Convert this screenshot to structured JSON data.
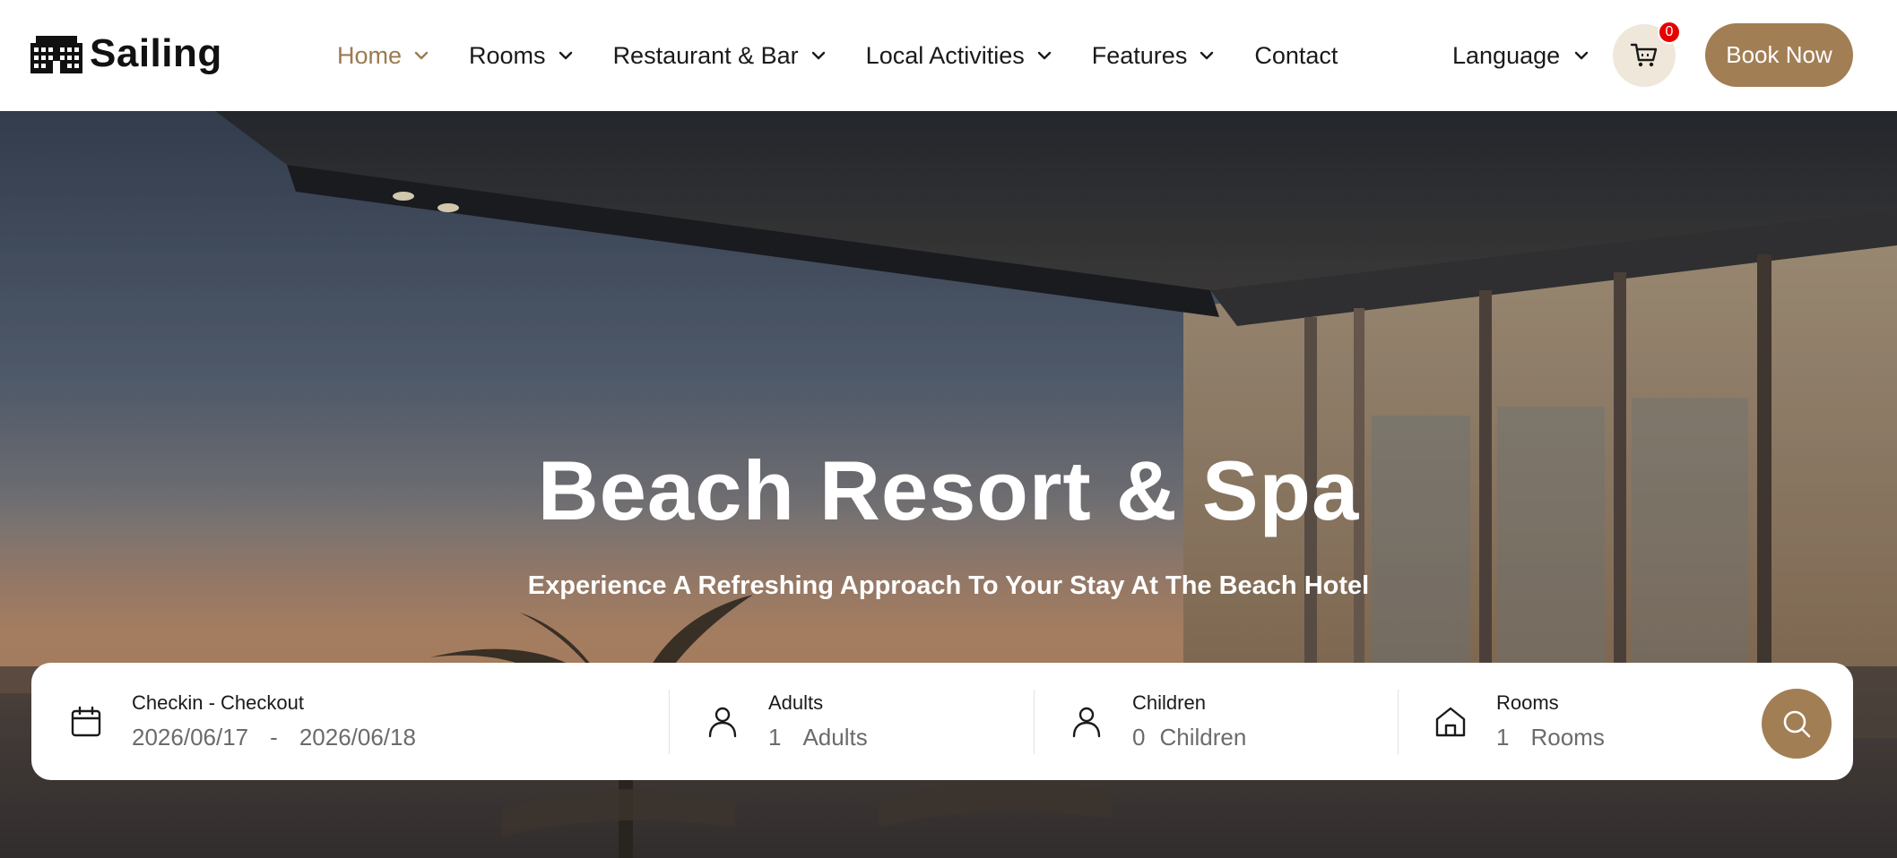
{
  "brand": {
    "name": "Sailing",
    "logo_icon": "hotel-building-icon"
  },
  "nav": {
    "items": [
      {
        "label": "Home",
        "active": true
      },
      {
        "label": "Rooms"
      },
      {
        "label": "Restaurant & Bar"
      },
      {
        "label": "Local Activities"
      },
      {
        "label": "Features"
      },
      {
        "label": "Contact"
      }
    ],
    "language_label": "Language"
  },
  "cart": {
    "count": "0",
    "icon": "cart-icon"
  },
  "book_button": {
    "label": "Book Now"
  },
  "hero": {
    "title": "Beach Resort & Spa",
    "subtitle": "Experience A Refreshing Approach To Your Stay At The Beach Hotel"
  },
  "booking": {
    "dates": {
      "label": "Checkin - Checkout",
      "checkin": "2026/06/17",
      "separator": "-",
      "checkout": "2026/06/18"
    },
    "adults": {
      "label": "Adults",
      "value": "1",
      "unit": "Adults"
    },
    "children": {
      "label": "Children",
      "value": "0",
      "unit": "Children"
    },
    "rooms": {
      "label": "Rooms",
      "value": "1",
      "unit": "Rooms"
    }
  },
  "colors": {
    "accent": "#a27e54",
    "accent_light": "#efe7da",
    "badge": "#e60000",
    "text": "#1a1a1a"
  }
}
